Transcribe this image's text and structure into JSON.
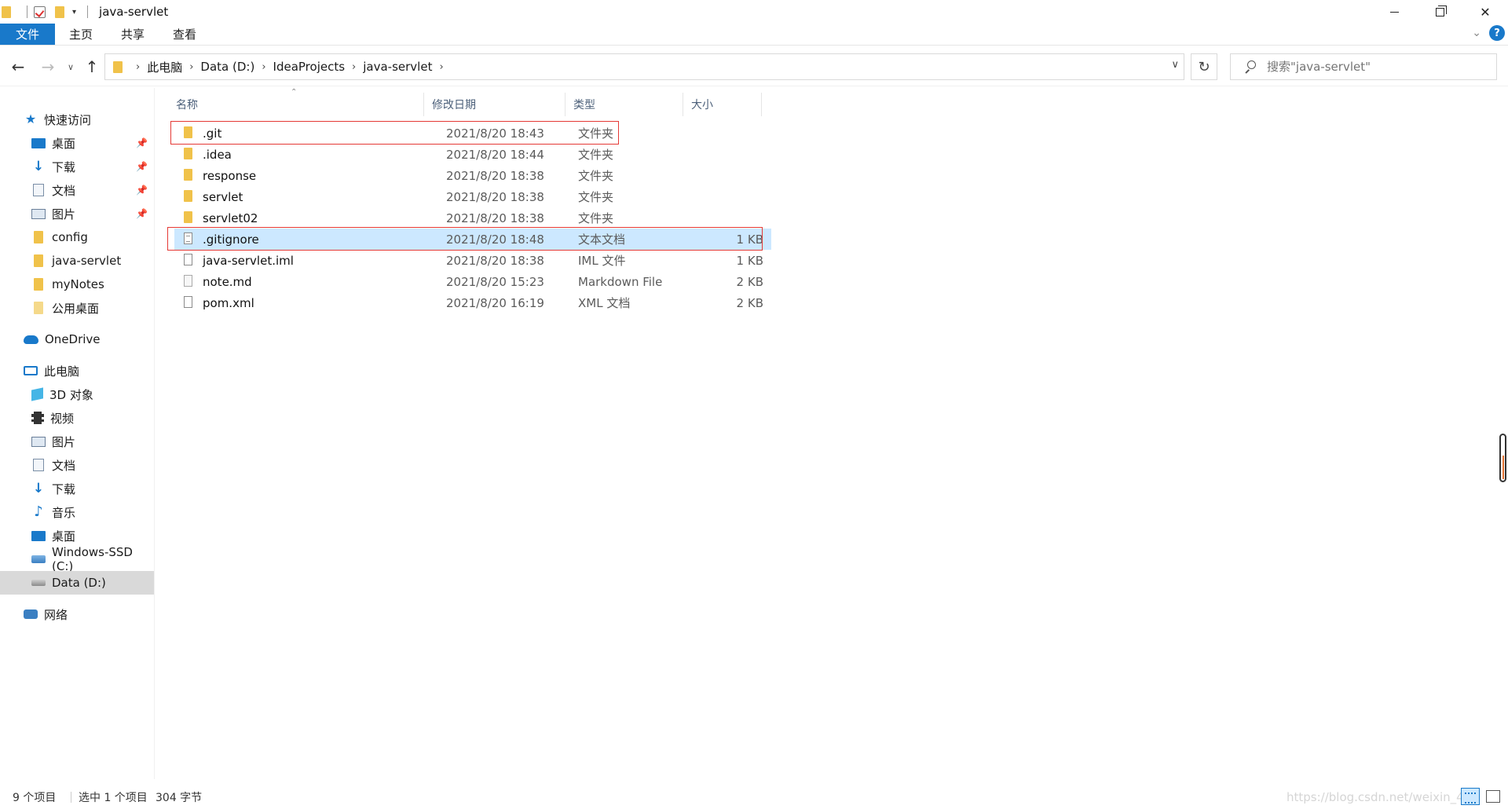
{
  "window": {
    "title": "java-servlet"
  },
  "ribbon": {
    "tabs": [
      "文件",
      "主页",
      "共享",
      "查看"
    ],
    "help": "?"
  },
  "address": {
    "crumbs": [
      "此电脑",
      "Data (D:)",
      "IdeaProjects",
      "java-servlet"
    ],
    "search_placeholder": "搜索\"java-servlet\""
  },
  "nav": {
    "quick_access": "快速访问",
    "quick_items": [
      "桌面",
      "下载",
      "文档",
      "图片",
      "config",
      "java-servlet",
      "myNotes",
      "公用桌面"
    ],
    "onedrive": "OneDrive",
    "this_pc": "此电脑",
    "pc_items": [
      "3D 对象",
      "视频",
      "图片",
      "文档",
      "下载",
      "音乐",
      "桌面",
      "Windows-SSD (C:)",
      "Data (D:)"
    ],
    "network": "网络",
    "selected": "Data (D:)"
  },
  "columns": {
    "name": "名称",
    "date": "修改日期",
    "type": "类型",
    "size": "大小"
  },
  "files": [
    {
      "name": ".git",
      "date": "2021/8/20 18:43",
      "type": "文件夹",
      "size": "",
      "icon": "folder-icon"
    },
    {
      "name": ".idea",
      "date": "2021/8/20 18:44",
      "type": "文件夹",
      "size": "",
      "icon": "folder-icon"
    },
    {
      "name": "response",
      "date": "2021/8/20 18:38",
      "type": "文件夹",
      "size": "",
      "icon": "folder-icon"
    },
    {
      "name": "servlet",
      "date": "2021/8/20 18:38",
      "type": "文件夹",
      "size": "",
      "icon": "folder-icon"
    },
    {
      "name": "servlet02",
      "date": "2021/8/20 18:38",
      "type": "文件夹",
      "size": "",
      "icon": "folder-icon"
    },
    {
      "name": ".gitignore",
      "date": "2021/8/20 18:48",
      "type": "文本文档",
      "size": "1 KB",
      "icon": "text-file-icon"
    },
    {
      "name": "java-servlet.iml",
      "date": "2021/8/20 18:38",
      "type": "IML 文件",
      "size": "1 KB",
      "icon": "file-icon"
    },
    {
      "name": "note.md",
      "date": "2021/8/20 15:23",
      "type": "Markdown File",
      "size": "2 KB",
      "icon": "markdown-file-icon"
    },
    {
      "name": "pom.xml",
      "date": "2021/8/20 16:19",
      "type": "XML 文档",
      "size": "2 KB",
      "icon": "file-icon"
    }
  ],
  "selected_file": ".gitignore",
  "status": {
    "count": "9 个项目",
    "selection": "选中 1 个项目",
    "bytes": "304 字节"
  },
  "watermark": "https://blog.csdn.net/weixin_45",
  "colors": {
    "accent": "#1979ca",
    "selection": "#cce8ff",
    "highlight_box": "#e53935",
    "folder": "#f0c24a"
  }
}
